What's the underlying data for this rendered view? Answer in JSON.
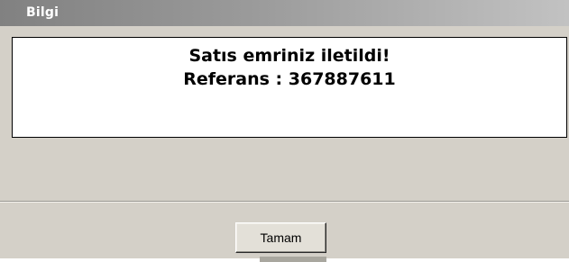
{
  "window": {
    "title": "Bilgi"
  },
  "message": {
    "line1": "Satıs emriniz iletildi!",
    "line2": "Referans : 367887611"
  },
  "buttons": {
    "ok_label": "Tamam"
  },
  "colors": {
    "titlebar_start": "#818181",
    "titlebar_end": "#c2c2c2",
    "dialog_background": "#d4d0c8",
    "message_background": "#ffffff"
  }
}
